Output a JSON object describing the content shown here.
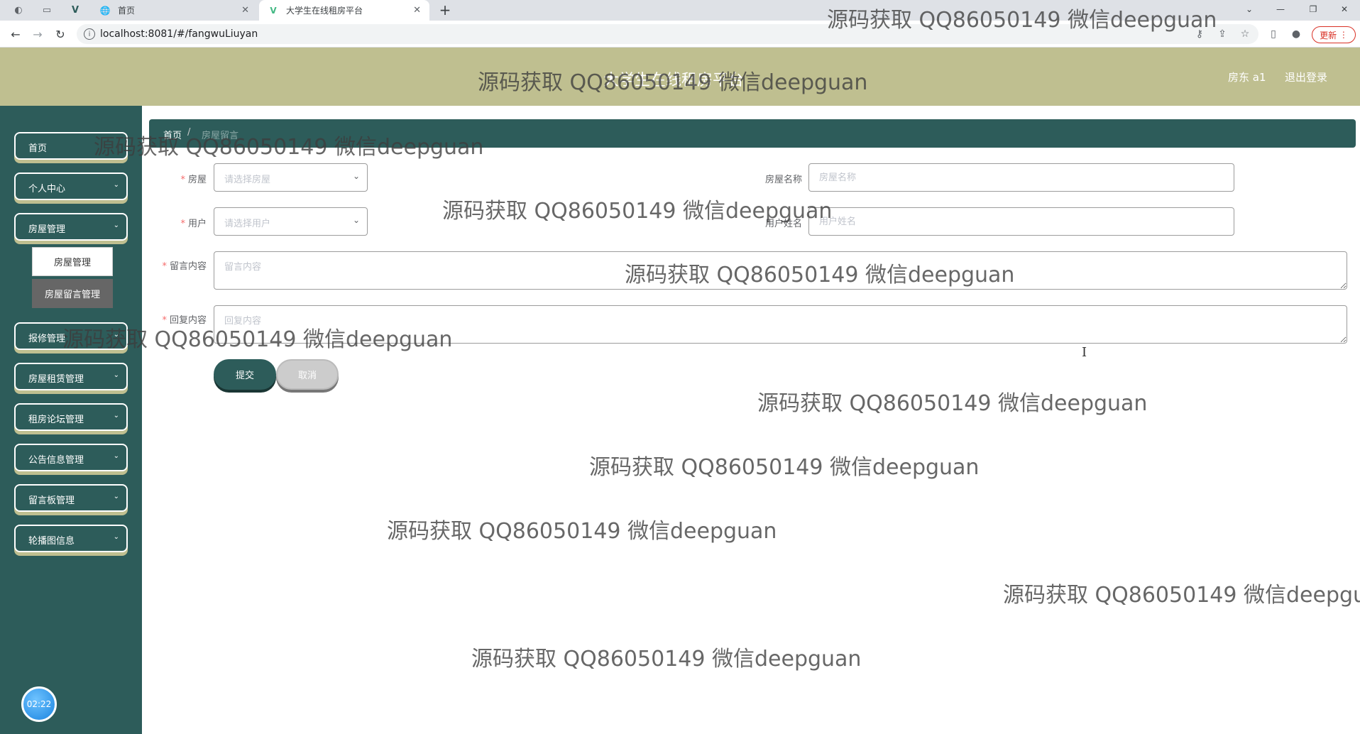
{
  "browser": {
    "tabs": [
      {
        "title": "首页",
        "favicon": "globe-icon"
      },
      {
        "title": "大学生在线租房平台",
        "favicon": "vue-logo-icon"
      }
    ],
    "url": "localhost:8081/#/fangwuLiuyan",
    "update_label": "更新"
  },
  "header": {
    "title": "大学生在线租房平台",
    "user": "房东 a1",
    "logout": "退出登录",
    "bg_color": "#bfbf90"
  },
  "sidebar": {
    "bg_color": "#2d5c5a",
    "items": [
      {
        "label": "首页"
      },
      {
        "label": "个人中心"
      },
      {
        "label": "房屋管理"
      },
      {
        "label": "报修管理"
      },
      {
        "label": "房屋租赁管理"
      },
      {
        "label": "租房论坛管理"
      },
      {
        "label": "公告信息管理"
      },
      {
        "label": "留言板管理"
      },
      {
        "label": "轮播图信息"
      }
    ],
    "submenu": [
      {
        "label": "房屋管理"
      },
      {
        "label": "房屋留言管理"
      }
    ],
    "clock": "02:22"
  },
  "breadcrumb": {
    "home": "首页",
    "separator": "/",
    "current": "房屋留言"
  },
  "form": {
    "house_label": "房屋",
    "house_placeholder": "请选择房屋",
    "house_name_label": "房屋名称",
    "house_name_placeholder": "房屋名称",
    "user_label": "用户",
    "user_placeholder": "请选择用户",
    "user_name_label": "用户姓名",
    "user_name_placeholder": "用户姓名",
    "message_label": "留言内容",
    "message_placeholder": "留言内容",
    "reply_label": "回复内容",
    "reply_placeholder": "回复内容",
    "submit_label": "提交",
    "cancel_label": "取消"
  },
  "watermark": "源码获取 QQ86050149 微信deepguan"
}
